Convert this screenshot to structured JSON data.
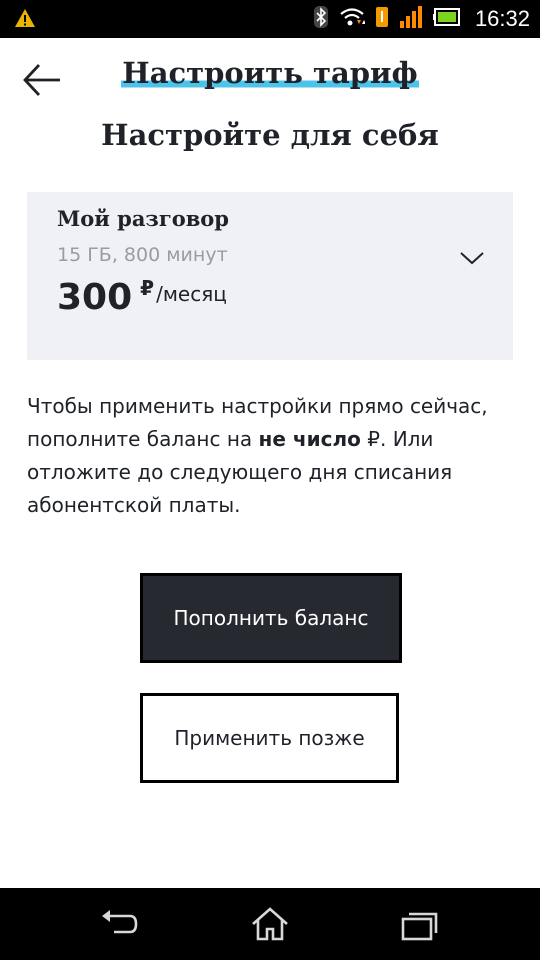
{
  "status_bar": {
    "time": "16:32",
    "icons": [
      "warning-icon",
      "bluetooth-icon",
      "wifi-icon",
      "notification-icon",
      "signal-icon",
      "battery-icon"
    ]
  },
  "header": {
    "title": "Настроить тариф",
    "back_icon": "arrow-left-icon"
  },
  "subtitle": "Настройте для себя",
  "tariff": {
    "name": "Мой разговор",
    "details": "15 ГБ, 800 минут",
    "price": "300",
    "currency": "₽",
    "period": "/месяц",
    "expand_icon": "chevron-down-icon"
  },
  "info": {
    "part1": "Чтобы применить настройки прямо сейчас, пополните баланс на ",
    "bold": "не число",
    "part2": " ₽. Или отложите до следующего дня списания абонентской платы."
  },
  "buttons": {
    "topup_label": "Пополнить баланс",
    "later_label": "Применить позже"
  },
  "nav_bar": {
    "icons": [
      "back-icon",
      "home-icon",
      "recents-icon"
    ]
  },
  "colors": {
    "accent_underline": "#4ec3ea",
    "card_background": "#f0f1f6",
    "primary_button": "#262930",
    "text": "#1f2229",
    "muted_text": "#9a9ca3"
  }
}
